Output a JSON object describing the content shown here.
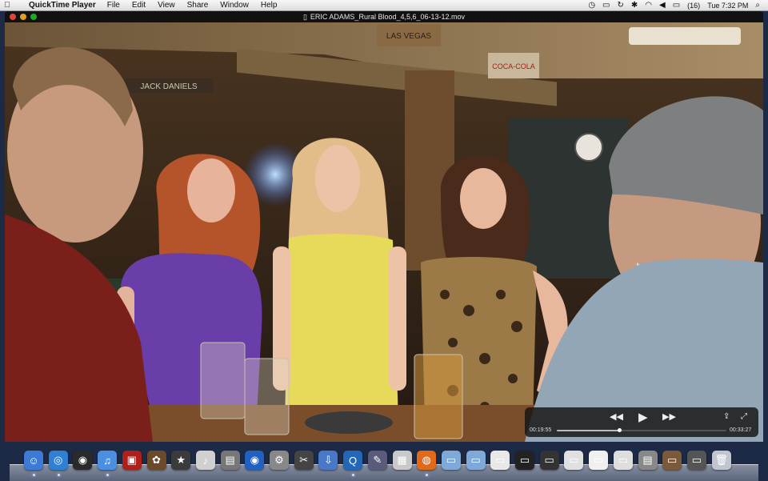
{
  "menubar": {
    "app_name": "QuickTime Player",
    "items": [
      "File",
      "Edit",
      "View",
      "Share",
      "Window",
      "Help"
    ],
    "battery": "(16)",
    "clock": "Tue 7:32 PM",
    "icons": [
      "apple-icon",
      "time-machine-icon",
      "display-icon",
      "sync-icon",
      "bluetooth-icon",
      "wifi-icon",
      "volume-icon",
      "battery-icon",
      "spotlight-icon"
    ]
  },
  "window": {
    "title": "ERIC ADAMS_Rural Blood_4,5,6_06-13-12.mov"
  },
  "video": {
    "signs": [
      "JACK DANIELS",
      "LAS VEGAS",
      "COCA-COLA"
    ]
  },
  "player": {
    "elapsed": "00:19:55",
    "remaining": "00:33:27",
    "progress": 0.37
  },
  "dock": {
    "apps": [
      {
        "name": "finder",
        "color": "#3d7ad6",
        "glyph": "☺"
      },
      {
        "name": "safari",
        "color": "#2f7fd2",
        "glyph": "◎"
      },
      {
        "name": "dashboard",
        "color": "#2a2a2a",
        "glyph": "◉"
      },
      {
        "name": "itunes",
        "color": "#4a8fe0",
        "glyph": "♫"
      },
      {
        "name": "photo-booth",
        "color": "#b0201a",
        "glyph": "▣"
      },
      {
        "name": "iphoto",
        "color": "#6b4a2a",
        "glyph": "✿"
      },
      {
        "name": "imovie",
        "color": "#3b3b3b",
        "glyph": "★"
      },
      {
        "name": "garageband",
        "color": "#d0d0d0",
        "glyph": "♪"
      },
      {
        "name": "image-capture",
        "color": "#777777",
        "glyph": "▤"
      },
      {
        "name": "dvd-player",
        "color": "#2060c0",
        "glyph": "◉"
      },
      {
        "name": "system-preferences",
        "color": "#888888",
        "glyph": "⚙"
      },
      {
        "name": "final-cut",
        "color": "#444444",
        "glyph": "✂"
      },
      {
        "name": "downloader",
        "color": "#4a78c8",
        "glyph": "⇩"
      },
      {
        "name": "quicktime",
        "color": "#2466b8",
        "glyph": "Q"
      },
      {
        "name": "compressor",
        "color": "#5a5a7a",
        "glyph": "✎"
      },
      {
        "name": "preview",
        "color": "#c9c9c9",
        "glyph": "▦"
      },
      {
        "name": "firefox",
        "color": "#e06a1a",
        "glyph": "◍"
      },
      {
        "name": "applications-folder",
        "color": "#7fa9d8",
        "glyph": "▭"
      },
      {
        "name": "documents-folder",
        "color": "#7fa9d8",
        "glyph": "▭"
      },
      {
        "name": "window-1",
        "color": "#e8e8e8",
        "glyph": "▭"
      },
      {
        "name": "window-2",
        "color": "#222222",
        "glyph": "▭"
      },
      {
        "name": "window-3",
        "color": "#333333",
        "glyph": "▭"
      },
      {
        "name": "window-4",
        "color": "#e0e0e0",
        "glyph": "▭"
      },
      {
        "name": "window-5",
        "color": "#f0f0f0",
        "glyph": "▭"
      },
      {
        "name": "window-6",
        "color": "#dedede",
        "glyph": "▭"
      },
      {
        "name": "window-7",
        "color": "#888888",
        "glyph": "▤"
      },
      {
        "name": "window-8",
        "color": "#7a5a3a",
        "glyph": "▭"
      },
      {
        "name": "window-9",
        "color": "#555555",
        "glyph": "▭"
      },
      {
        "name": "trash",
        "color": "#bfc6cf",
        "glyph": "🗑"
      }
    ]
  }
}
